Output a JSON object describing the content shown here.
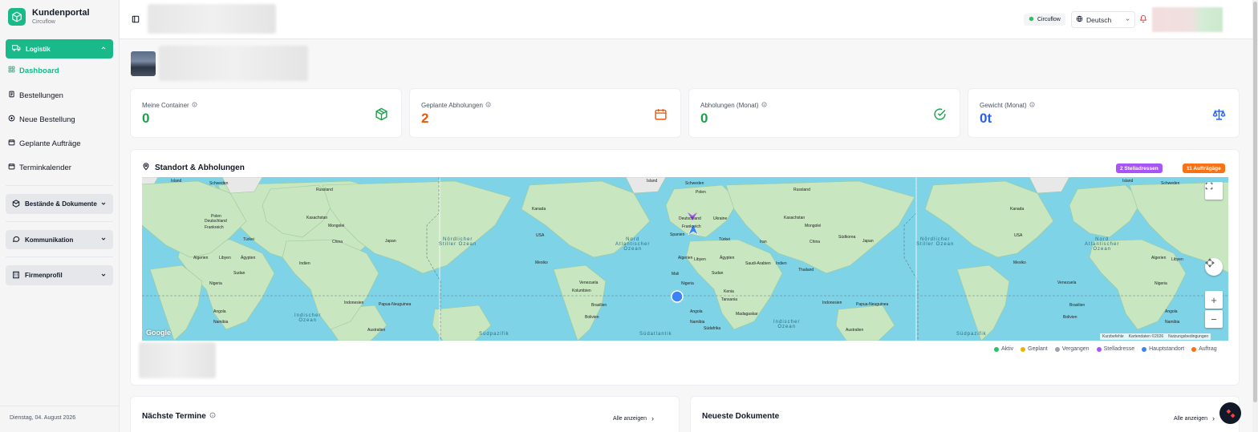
{
  "brand": {
    "title": "Kundenportal",
    "subtitle": "Circuflow"
  },
  "sidebar": {
    "group_logistik": "Logistik",
    "items": [
      {
        "label": "Dashboard"
      },
      {
        "label": "Bestellungen"
      },
      {
        "label": "Neue Bestellung"
      },
      {
        "label": "Geplante Aufträge"
      },
      {
        "label": "Terminkalender"
      }
    ],
    "group_bestaende": "Bestände & Dokumente",
    "group_kommunikation": "Kommunikation",
    "group_firmenprofil": "Firmenprofil",
    "date": "Dienstag, 04. August 2026"
  },
  "header": {
    "org_badge": "Circuflow",
    "language": "Deutsch"
  },
  "stats": [
    {
      "label": "Meine Container",
      "value": "0",
      "color": "#16a34a"
    },
    {
      "label": "Geplante Abholungen",
      "value": "2",
      "color": "#ea580c"
    },
    {
      "label": "Abholungen (Monat)",
      "value": "0",
      "color": "#16a34a"
    },
    {
      "label": "Gewicht (Monat)",
      "value": "0t",
      "color": "#2563eb"
    }
  ],
  "map": {
    "title": "Standort & Abholungen",
    "badge_pickup_addresses": "2 Stelladressen",
    "badge_orders": "11 Aufträgäge",
    "google": "Google",
    "attribution": [
      "Kurzbefehle",
      "Kartendaten ©2026",
      "Nutzungsbedingungen"
    ],
    "legend": [
      {
        "label": "Aktiv",
        "color": "#22c55e"
      },
      {
        "label": "Geplant",
        "color": "#eab308"
      },
      {
        "label": "Vergangen",
        "color": "#9ca3af"
      },
      {
        "label": "Stelladresse",
        "color": "#a855f7"
      },
      {
        "label": "Hauptstandort",
        "color": "#3b82f6"
      },
      {
        "label": "Auftrag",
        "color": "#f97316"
      }
    ],
    "labels": {
      "island": "Island",
      "schweden": "Schweden",
      "russland": "Russland",
      "kasachstan": "Kasachstan",
      "mongolei": "Mongolei",
      "china": "China",
      "indien": "Indien",
      "turkei": "Türkei",
      "algerien": "Algerien",
      "libyen": "Libyen",
      "agypten": "Ägypten",
      "sudan": "Sudan",
      "nigeria": "Nigeria",
      "angola": "Angola",
      "namibia": "Namibia",
      "madagaskar": "Madagaskar",
      "usa": "USA",
      "kanada": "Kanada",
      "mexiko": "Mexiko",
      "venezuela": "Venezuela",
      "kolumbien": "Kolumbien",
      "brasilien": "Brasilien",
      "bolivien": "Bolivien",
      "australien": "Australien",
      "indonesien": "Indonesien",
      "papua": "Papua-Neuguinea",
      "japan": "Japan",
      "sudkorea": "Südkorea",
      "saudi": "Saudi-Arabien",
      "iran": "Iran",
      "thailand": "Thailand",
      "deutschland": "Deutschland",
      "frankreich": "Frankreich",
      "spanien": "Spanien",
      "polen": "Polen",
      "ukraine": "Ukraine",
      "mali": "Mali",
      "kenia": "Kenia",
      "tansania": "Tansania",
      "sudafrika": "Südafrika",
      "nord_stiller_1": "Nördlicher",
      "nord_stiller_2": "Stiller Ozean",
      "nord_atl_1": "Nord",
      "nord_atl_2": "Atlantischer",
      "nord_atl_3": "Ozean",
      "indischer_1": "Indischer",
      "indischer_2": "Ozean",
      "sudpazifik": "Südpazifik",
      "sudatlantik": "Südatlantik"
    }
  },
  "bottom": {
    "termine_title": "Nächste Termine",
    "termine_more": "Alle anzeigen",
    "dokumente_title": "Neueste Dokumente",
    "dokumente_more": "Alle anzeigen"
  }
}
